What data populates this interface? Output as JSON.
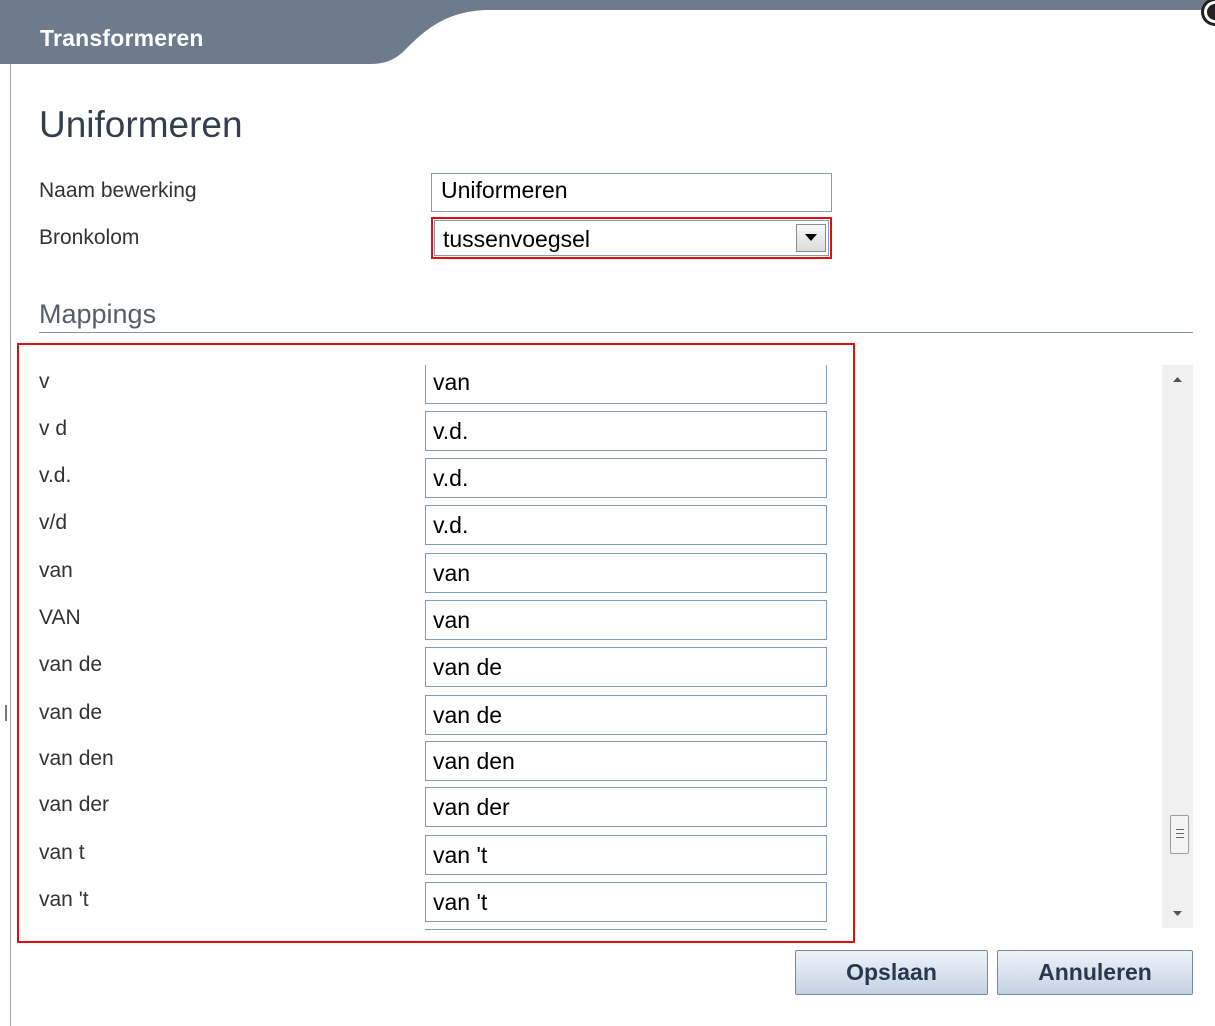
{
  "dialog": {
    "title": "Transformeren",
    "heading": "Uniformeren"
  },
  "form": {
    "name_label": "Naam bewerking",
    "name_value": "Uniformeren",
    "source_label": "Bronkolom",
    "source_value": "tussenvoegsel"
  },
  "mappings": {
    "title": "Mappings",
    "rows": [
      {
        "source": "v",
        "target": "van"
      },
      {
        "source": "v d",
        "target": "v.d."
      },
      {
        "source": "v.d.",
        "target": "v.d."
      },
      {
        "source": "v/d",
        "target": "v.d."
      },
      {
        "source": "van",
        "target": "van"
      },
      {
        "source": "VAN",
        "target": "van"
      },
      {
        "source": "van de",
        "target": "van de"
      },
      {
        "source": "van de",
        "target": "van de"
      },
      {
        "source": "van den",
        "target": "van den"
      },
      {
        "source": "van der",
        "target": "van der"
      },
      {
        "source": "van t",
        "target": "van 't"
      },
      {
        "source": "van 't",
        "target": "van 't"
      }
    ]
  },
  "buttons": {
    "save": "Opslaan",
    "cancel": "Annuleren"
  },
  "colors": {
    "title_bar": "#6e7b8d",
    "highlight": "#e01010",
    "button_text": "#28384e"
  },
  "icons": {
    "close": "close-icon",
    "dropdown": "chevron-down-icon",
    "scroll_up": "scroll-up-icon",
    "scroll_down": "scroll-down-icon"
  }
}
